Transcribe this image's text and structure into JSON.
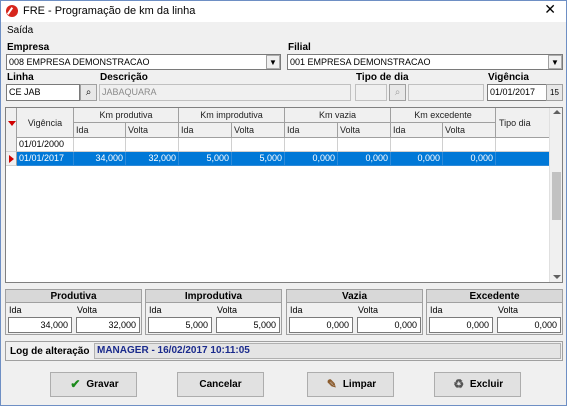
{
  "window": {
    "title": "FRE - Programação de km da linha",
    "close_glyph": "✕"
  },
  "menu": {
    "item": "Saída"
  },
  "form": {
    "empresa": {
      "label": "Empresa",
      "value": "008 EMPRESA DEMONSTRACAO"
    },
    "filial": {
      "label": "Filial",
      "value": "001 EMPRESA DEMONSTRACAO"
    },
    "linha": {
      "label": "Linha",
      "value": "CE JAB"
    },
    "descricao": {
      "label": "Descrição",
      "value": "JABAQUARA"
    },
    "tipo_dia": {
      "label": "Tipo de dia",
      "value": ""
    },
    "vigencia": {
      "label": "Vigência",
      "value": "01/01/2017"
    }
  },
  "grid": {
    "headers": {
      "vigencia": "Vigência",
      "km_produtiva": "Km produtiva",
      "km_improdutiva": "Km improdutiva",
      "km_vazia": "Km vazia",
      "km_excedente": "Km excedente",
      "tipo_dia": "Tipo dia",
      "ida": "Ida",
      "volta": "Volta"
    },
    "rows": [
      {
        "vigencia": "01/01/2000",
        "prod_ida": "",
        "prod_volta": "",
        "improd_ida": "",
        "improd_volta": "",
        "vazia_ida": "",
        "vazia_volta": "",
        "exc_ida": "",
        "exc_volta": "",
        "tipo_dia": ""
      },
      {
        "vigencia": "01/01/2017",
        "prod_ida": "34,000",
        "prod_volta": "32,000",
        "improd_ida": "5,000",
        "improd_volta": "5,000",
        "vazia_ida": "0,000",
        "vazia_volta": "0,000",
        "exc_ida": "0,000",
        "exc_volta": "0,000",
        "tipo_dia": ""
      }
    ]
  },
  "summary": {
    "ida_label": "Ida",
    "volta_label": "Volta",
    "produtiva": {
      "title": "Produtiva",
      "ida": "34,000",
      "volta": "32,000"
    },
    "improdutiva": {
      "title": "Improdutiva",
      "ida": "5,000",
      "volta": "5,000"
    },
    "vazia": {
      "title": "Vazia",
      "ida": "0,000",
      "volta": "0,000"
    },
    "excedente": {
      "title": "Excedente",
      "ida": "0,000",
      "volta": "0,000"
    }
  },
  "log": {
    "label": "Log de alteração",
    "value": "MANAGER - 16/02/2017 10:11:05"
  },
  "buttons": {
    "gravar": "Gravar",
    "cancelar": "Cancelar",
    "limpar": "Limpar",
    "excluir": "Excluir"
  },
  "colors": {
    "selection": "#0078d7",
    "log_text": "#1a2a8c",
    "indicator": "#d00000"
  }
}
